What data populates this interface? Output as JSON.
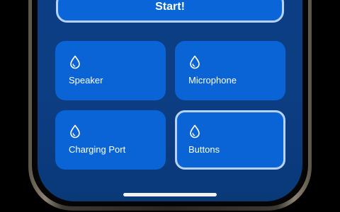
{
  "start_button": {
    "label": "Start!"
  },
  "tiles": [
    {
      "label": "Speaker",
      "icon": "drop-icon",
      "selected": false
    },
    {
      "label": "Microphone",
      "icon": "drop-icon",
      "selected": false
    },
    {
      "label": "Charging Port",
      "icon": "drop-icon",
      "selected": false
    },
    {
      "label": "Buttons",
      "icon": "drop-icon",
      "selected": true
    }
  ],
  "colors": {
    "background": "#0b3f86",
    "tile": "#0a64d6",
    "selected_border": "#b8d2f5",
    "text": "#ffffff"
  }
}
